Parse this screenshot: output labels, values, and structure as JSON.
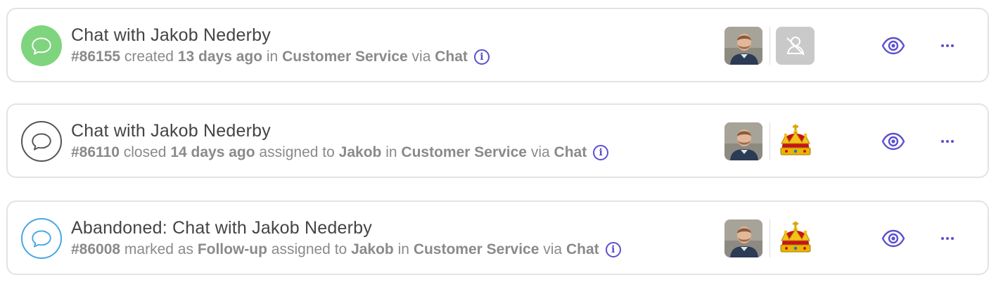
{
  "colors": {
    "accent": "#5b4fd0",
    "open_status": "#7fd47e",
    "closed_status": "#555555",
    "abandoned_status": "#45a8e6",
    "muted_text": "#8a8a8a"
  },
  "conversations": [
    {
      "status": "open",
      "status_icon": "chat-bubble-icon",
      "title": "Chat with Jakob Nederby",
      "id": "#86155",
      "action": "created",
      "time": "13 days ago",
      "in_word": "in",
      "team": "Customer Service",
      "via_word": "via",
      "channel": "Chat",
      "assignee_avatar": "unassigned-icon"
    },
    {
      "status": "closed",
      "status_icon": "chat-bubble-icon",
      "title": "Chat with Jakob Nederby",
      "id": "#86110",
      "action": "closed",
      "time": "14 days ago",
      "assigned_word": "assigned to",
      "assignee": "Jakob",
      "in_word": "in",
      "team": "Customer Service",
      "via_word": "via",
      "channel": "Chat",
      "assignee_avatar": "crown-icon"
    },
    {
      "status": "abandoned",
      "status_icon": "chat-bubble-icon",
      "title": "Abandoned: Chat with Jakob Nederby",
      "id": "#86008",
      "action": "marked as",
      "label": "Follow-up",
      "assigned_word": "assigned to",
      "assignee": "Jakob",
      "in_word": "in",
      "team": "Customer Service",
      "via_word": "via",
      "channel": "Chat",
      "assignee_avatar": "crown-icon"
    }
  ]
}
